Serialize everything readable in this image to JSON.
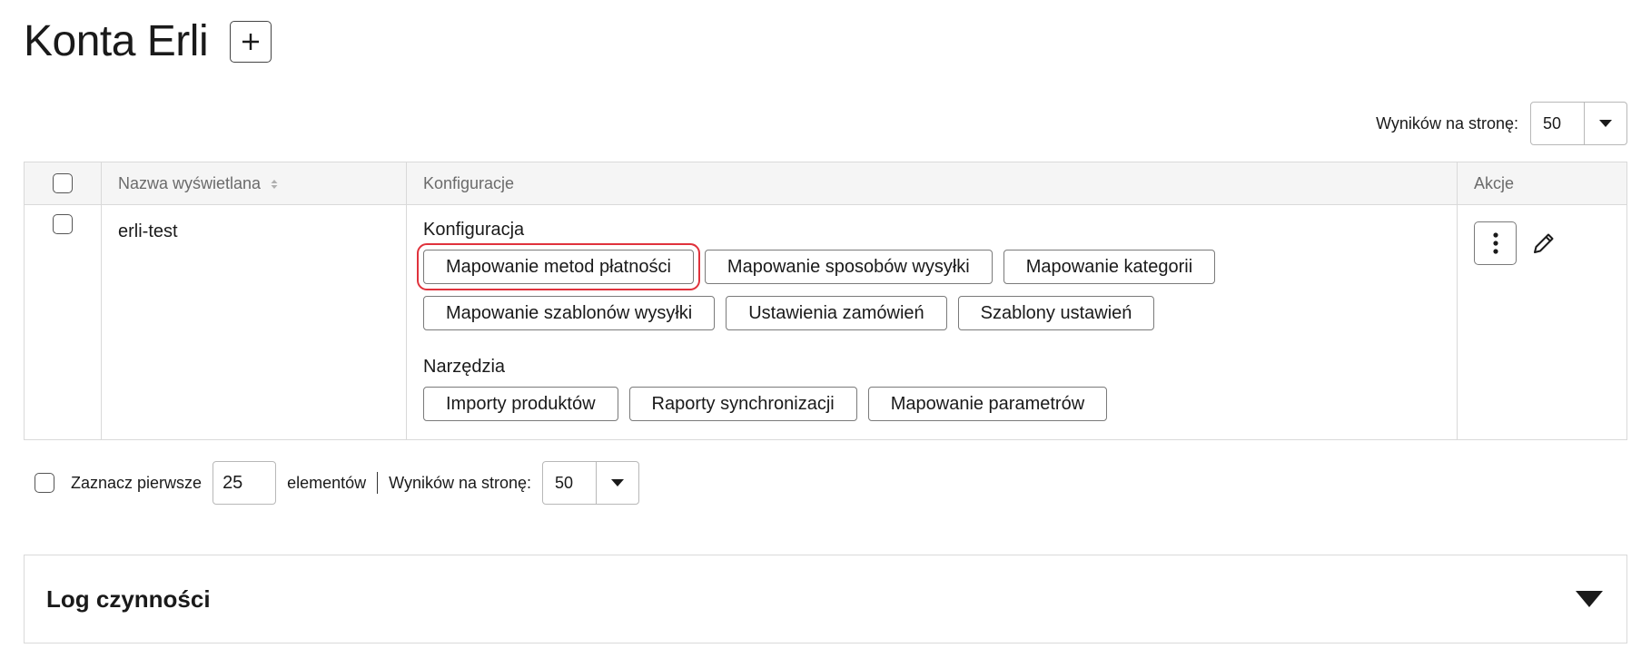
{
  "page": {
    "title": "Konta Erli"
  },
  "toolbar": {
    "add_icon": "plus-icon"
  },
  "pagination_top": {
    "label": "Wyników na stronę:",
    "value": "50"
  },
  "table": {
    "columns": {
      "name": "Nazwa wyświetlana",
      "config": "Konfiguracje",
      "actions": "Akcje"
    },
    "rows": [
      {
        "name": "erli-test",
        "config_section": "Konfiguracja",
        "config_buttons": [
          "Mapowanie metod płatności",
          "Mapowanie sposobów wysyłki",
          "Mapowanie kategorii",
          "Mapowanie szablonów wysyłki",
          "Ustawienia zamówień",
          "Szablony ustawień"
        ],
        "tools_section": "Narzędzia",
        "tools_buttons": [
          "Importy produktów",
          "Raporty synchronizacji",
          "Mapowanie parametrów"
        ]
      }
    ]
  },
  "footer": {
    "select_first_label": "Zaznacz pierwsze",
    "select_first_value": "25",
    "elements_label": "elementów",
    "per_page_label": "Wyników na stronę:",
    "per_page_value": "50"
  },
  "log_panel": {
    "title": "Log czynności"
  },
  "colors": {
    "highlight": "#e0323c",
    "header_bg": "#f5f5f5",
    "border": "#d9d9d9"
  }
}
